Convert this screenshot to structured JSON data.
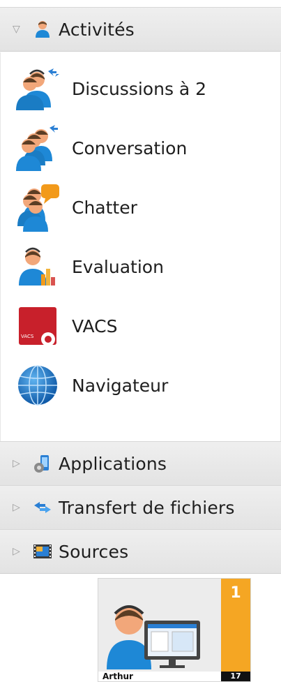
{
  "sections": {
    "activities": {
      "label": "Activités",
      "expanded": true,
      "icon": "person-icon"
    },
    "applications": {
      "label": "Applications",
      "expanded": false,
      "icon": "applications-icon"
    },
    "file_transfer": {
      "label": "Transfert de fichiers",
      "expanded": false,
      "icon": "transfer-arrows-icon"
    },
    "sources": {
      "label": "Sources",
      "expanded": false,
      "icon": "film-sources-icon"
    }
  },
  "activities": [
    {
      "label": "Discussions à 2",
      "icon": "two-people-discussion-icon"
    },
    {
      "label": "Conversation",
      "icon": "group-conversation-icon"
    },
    {
      "label": "Chatter",
      "icon": "chatter-icon"
    },
    {
      "label": "Evaluation",
      "icon": "evaluation-icon"
    },
    {
      "label": "VACS",
      "icon": "vacs-icon"
    },
    {
      "label": "Navigateur",
      "icon": "globe-icon"
    }
  ],
  "student_tile": {
    "name": "Arthur",
    "status_count": "1",
    "seat_number": "17",
    "colors": {
      "bar": "#f5a623",
      "number_bg": "#111111"
    }
  },
  "colors": {
    "header_bg": "#e8e8e8",
    "person_blue": "#1e88d6",
    "skin": "#f2a77a",
    "vacs_red": "#c8202b",
    "globe_blue": "#1b6fc2"
  }
}
